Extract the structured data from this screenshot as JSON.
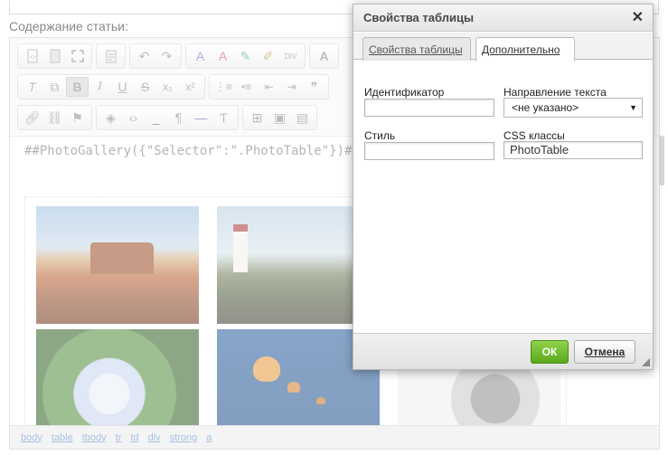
{
  "page": {
    "content_label": "Содержание статьи:"
  },
  "editor": {
    "gallery_code": "##PhotoGallery({\"Selector\":\".PhotoTable\"})##",
    "breadcrumb": [
      "body",
      "table",
      "tbody",
      "tr",
      "td",
      "div",
      "strong",
      "a"
    ]
  },
  "toolbar": {
    "row1": [
      "source-icon",
      "templates-icon",
      "maximize-icon",
      "paste-icon",
      "undo-icon",
      "redo-icon",
      "spellcheck-icon",
      "remove-format-icon",
      "eyedropper-icon",
      "brush-icon",
      "div-icon",
      "font-color-icon"
    ],
    "row2": [
      "clear-format-icon",
      "copy-format-icon",
      "bold-icon",
      "italic-icon",
      "underline-icon",
      "strikethrough-icon",
      "subscript-icon",
      "superscript-icon",
      "numbered-list-icon",
      "bulleted-list-icon",
      "outdent-icon",
      "indent-icon",
      "blockquote-icon"
    ],
    "row3": [
      "link-icon",
      "unlink-icon",
      "anchor-icon",
      "object-icon",
      "code-icon",
      "underscore-icon",
      "paragraph-icon",
      "hr-icon",
      "special-char-icon",
      "table-icon",
      "image-icon",
      "image-gallery-icon"
    ]
  },
  "dialog": {
    "title": "Свойства таблицы",
    "close": "✕",
    "tabs": [
      {
        "label": "Свойства таблицы",
        "active": false
      },
      {
        "label": "Дополнительно",
        "active": true
      }
    ],
    "fields": {
      "id_label": "Идентификатор",
      "id_value": "",
      "direction_label": "Направление текста",
      "direction_value": "<не указано>",
      "style_label": "Стиль",
      "style_value": "",
      "css_label": "CSS классы",
      "css_value": "PhotoTable"
    },
    "ok": "ОК",
    "cancel": "Отмена"
  },
  "colors": {
    "ok_green": "#5aa91c",
    "link_blue": "#5b8fd0"
  }
}
